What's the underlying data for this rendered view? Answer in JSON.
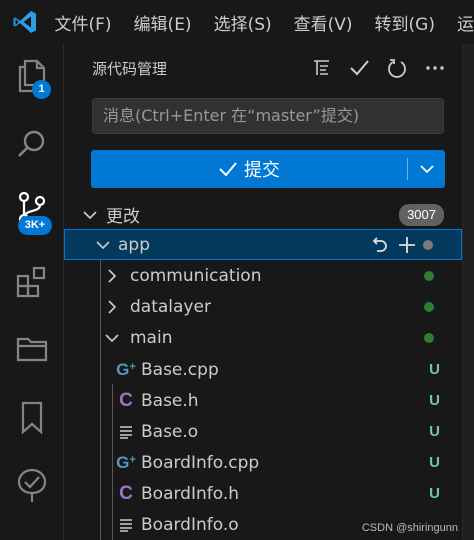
{
  "menu": {
    "items": [
      {
        "label": "文件(F)"
      },
      {
        "label": "编辑(E)"
      },
      {
        "label": "选择(S)"
      },
      {
        "label": "查看(V)"
      },
      {
        "label": "转到(G)"
      },
      {
        "label": "运"
      }
    ]
  },
  "activity": {
    "explorer_badge": "1",
    "scm_badge": "3K+"
  },
  "scm": {
    "title": "源代码管理",
    "message_placeholder": "消息(Ctrl+Enter 在“master”提交)",
    "commit_label": "提交",
    "changes_label": "更改",
    "changes_count": "3007"
  },
  "tree": {
    "app": "app",
    "communication": "communication",
    "datalayer": "datalayer",
    "main": "main",
    "files": [
      {
        "name": "Base.cpp",
        "status": "U",
        "icon": "cpp-icon"
      },
      {
        "name": "Base.h",
        "status": "U",
        "icon": "c-header-icon"
      },
      {
        "name": "Base.o",
        "status": "U",
        "icon": "text-file-icon"
      },
      {
        "name": "BoardInfo.cpp",
        "status": "U",
        "icon": "cpp-icon"
      },
      {
        "name": "BoardInfo.h",
        "status": "U",
        "icon": "c-header-icon"
      },
      {
        "name": "BoardInfo.o",
        "status": "U",
        "icon": "text-file-icon"
      }
    ]
  },
  "colors": {
    "accent": "#0078d4",
    "untracked": "#73c991",
    "folder_dot": "#2e7d32",
    "cpp_icon": "#519aba",
    "h_icon": "#a074c4"
  },
  "watermark": "CSDN @shiringunn"
}
